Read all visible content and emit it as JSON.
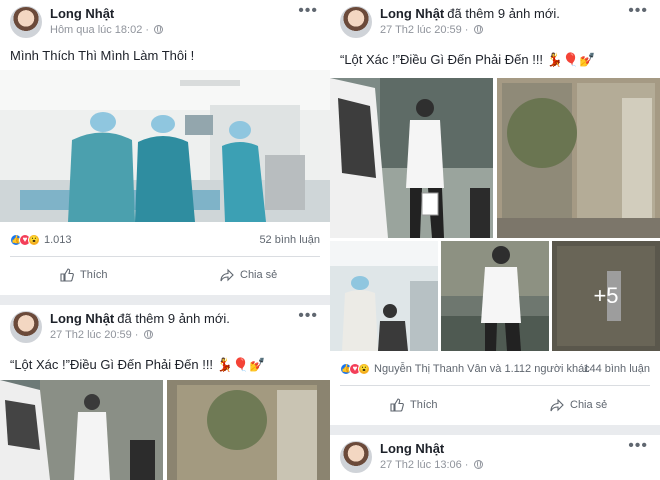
{
  "posts": [
    {
      "author": "Long Nhật",
      "action": "",
      "time": "Hôm qua lúc 18:02 · ",
      "text": "Mình Thích Thì Mình Làm Thôi !",
      "reactions_count": "1.013",
      "reactions_people": "",
      "comments": "52 bình luận",
      "like_label": "Thích",
      "share_label": "Chia sẻ"
    },
    {
      "author": "Long Nhật",
      "action": "đã thêm 9 ảnh mới.",
      "time": "27 Th2 lúc 20:59 · ",
      "text": "“Lột Xác !”Điều Gì Đến Phải Đến !!! 💃🎈💅",
      "reactions_count": "",
      "reactions_people": "",
      "comments": "",
      "like_label": "",
      "share_label": ""
    },
    {
      "author": "Long Nhật",
      "action": "đã thêm 9 ảnh mới.",
      "time": "27 Th2 lúc 20:59 · ",
      "text": "“Lột Xác !”Điều Gì Đến Phải Đến !!! 💃🎈💅",
      "reactions_count": "",
      "reactions_people": "Nguyễn Thị Thanh Vân và 1.112 người khác",
      "comments": "144 bình luận",
      "like_label": "Thích",
      "share_label": "Chia sẻ",
      "more_photos": "+5"
    },
    {
      "author": "Long Nhật",
      "action": "",
      "time": "27 Th2 lúc 13:06 · ",
      "text": "",
      "reactions_count": "",
      "reactions_people": "",
      "comments": "",
      "like_label": "",
      "share_label": ""
    }
  ],
  "more_glyph": "•••",
  "icons": [
    "more-options-icon",
    "globe-icon",
    "like-reaction-icon",
    "love-reaction-icon",
    "wow-reaction-icon",
    "thumbs-up-icon",
    "share-arrow-icon"
  ],
  "colors": {
    "background": "#e9ebee",
    "card": "#ffffff",
    "text": "#1d2129",
    "muted": "#90949c",
    "like_blue": "#1877f2"
  }
}
